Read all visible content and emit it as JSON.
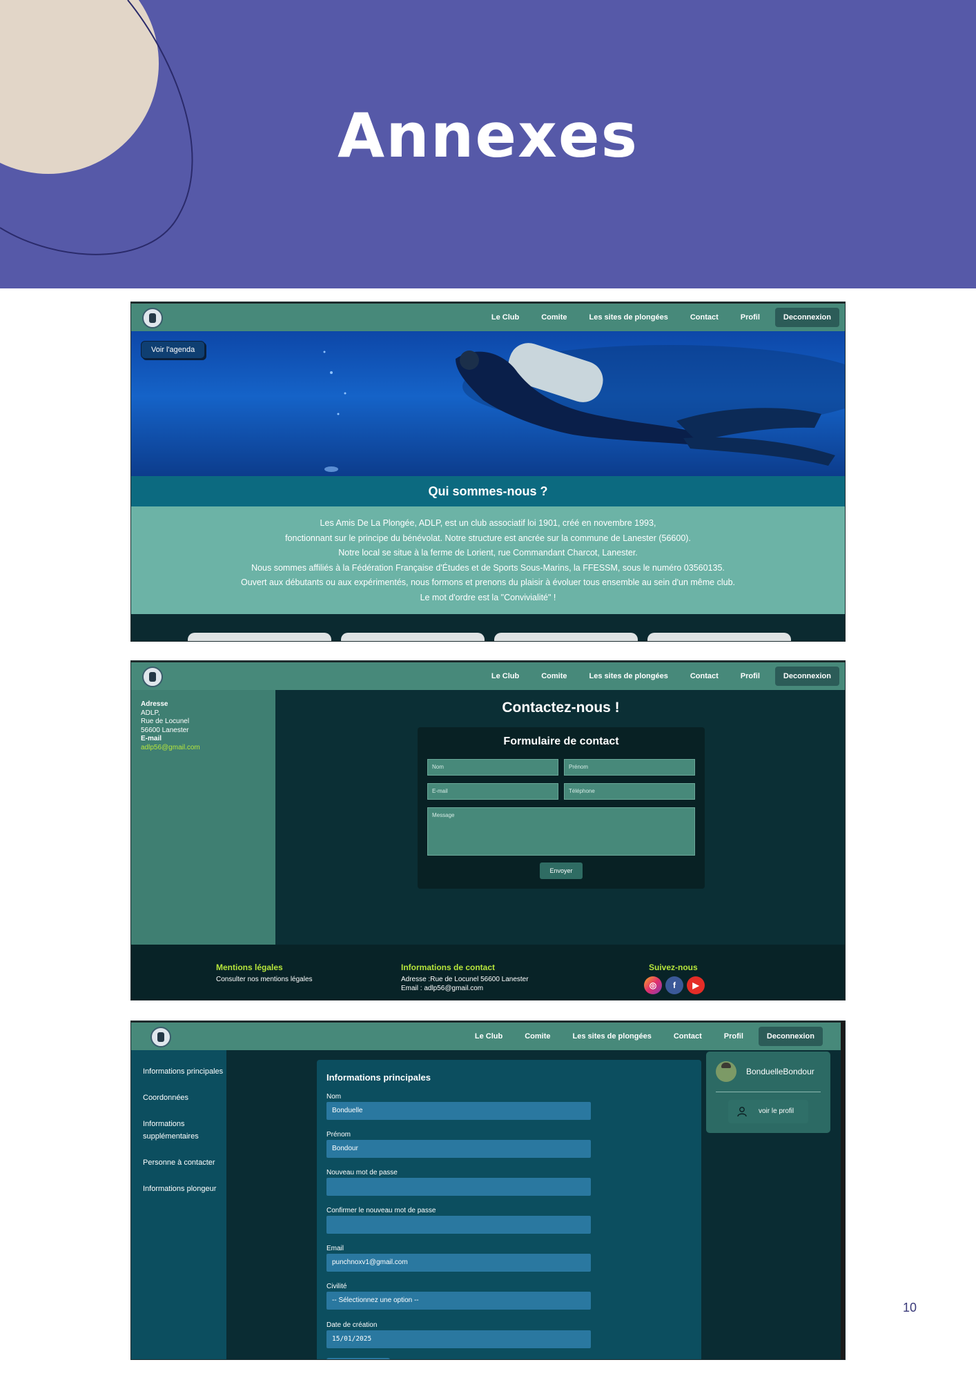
{
  "banner": {
    "title": "Annexes"
  },
  "page_number": "10",
  "nav": {
    "items": [
      "Le Club",
      "Comite",
      "Les sites de plongées",
      "Contact",
      "Profil"
    ],
    "logout": "Deconnexion"
  },
  "home": {
    "agenda_button": "Voir l'agenda",
    "section_title": "Qui sommes-nous ?",
    "paragraph_lines": [
      "Les Amis De La Plongée, ADLP, est un club associatif loi 1901, créé en novembre 1993,",
      "fonctionnant sur le principe du bénévolat. Notre structure est ancrée sur la commune de Lanester (56600).",
      "Notre local se situe à la ferme de Lorient, rue Commandant Charcot, Lanester.",
      "Nous sommes affiliés à la Fédération Française d'Études et de Sports Sous-Marins, la FFESSM, sous le numéro 03560135.",
      "Ouvert aux débutants ou aux expérimentés, nous formons et prenons du plaisir à évoluer tous ensemble au sein d'un même club.",
      "Le mot d'ordre est la \"Convivialité\" !"
    ]
  },
  "contact": {
    "sidebar": {
      "address_label": "Adresse",
      "address_lines": [
        "ADLP,",
        "Rue de Locunel",
        "56600 Lanester"
      ],
      "email_label": "E-mail",
      "email": "adlp56@gmail.com"
    },
    "title": "Contactez-nous !",
    "form_title": "Formulaire de contact",
    "placeholders": {
      "nom": "Nom",
      "prenom": "Prénom",
      "email": "E-mail",
      "telephone": "Téléphone",
      "message": "Message"
    },
    "send_button": "Envoyer",
    "footer": {
      "legal_title": "Mentions légales",
      "legal_text": "Consulter nos mentions légales",
      "info_title": "Informations de contact",
      "info_address": "Adresse :Rue de Locunel 56600 Lanester",
      "info_email": "Email : adlp56@gmail.com",
      "follow_title": "Suivez-nous"
    }
  },
  "profile": {
    "sidebar": [
      "Informations principales",
      "Coordonnées",
      "Informations supplémentaires",
      "Personne à contacter",
      "Informations plongeur"
    ],
    "section_title": "Informations principales",
    "fields": [
      {
        "label": "Nom",
        "value": "Bonduelle"
      },
      {
        "label": "Prénom",
        "value": "Bondour"
      },
      {
        "label": "Nouveau mot de passe",
        "value": ""
      },
      {
        "label": "Confirmer le nouveau mot de passe",
        "value": ""
      },
      {
        "label": "Email",
        "value": "punchnoxv1@gmail.com"
      },
      {
        "label": "Civilité",
        "value": "-- Sélectionnez une option --"
      },
      {
        "label": "Date de création",
        "value": "15/01/2025"
      }
    ],
    "user_name": "BonduelleBondour",
    "view_profile": "voir le profil"
  },
  "colors": {
    "banner": "#5659a8",
    "nav": "#47897a",
    "accent_green": "#b7e63c",
    "panel": "#0c4e5f"
  }
}
